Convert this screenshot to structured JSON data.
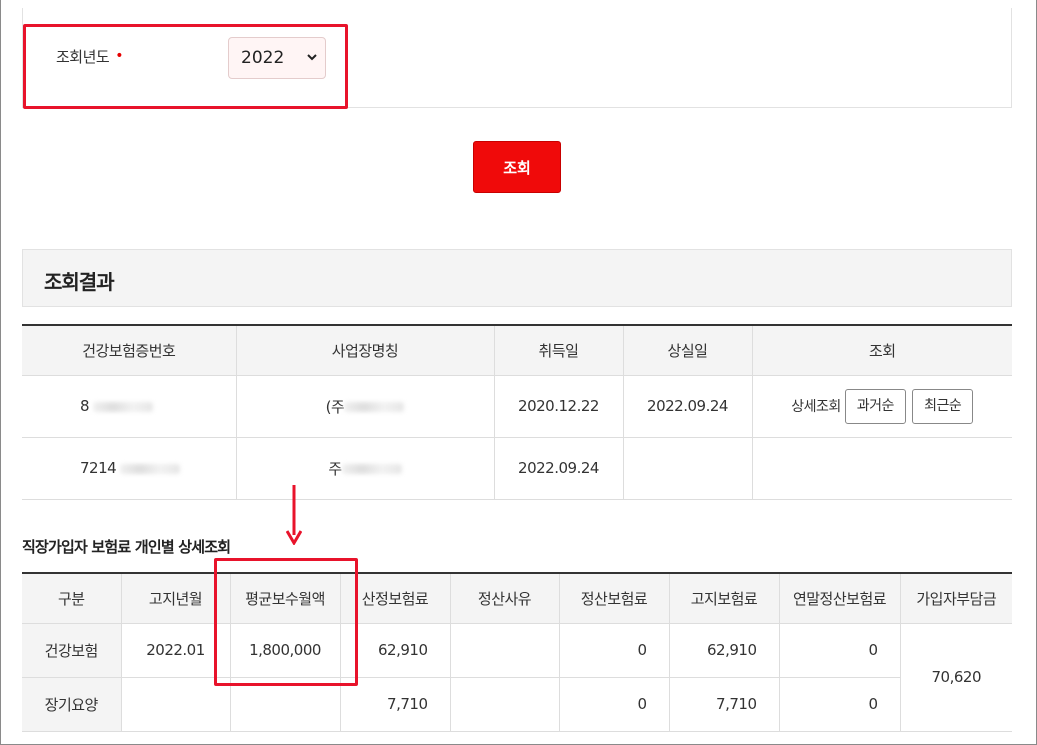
{
  "search": {
    "year_label": "조회년도",
    "required_mark": "•",
    "year_value": "2022",
    "button_label": "조회"
  },
  "result": {
    "title": "조회결과",
    "columns": [
      "건강보험증번호",
      "사업장명칭",
      "취득일",
      "상실일",
      "조회"
    ],
    "rows": [
      {
        "card_no": "8",
        "company": "(주",
        "acquired": "2020.12.22",
        "lost": "2022.09.24",
        "detail_label": "상세조회",
        "btn_past": "과거순",
        "btn_recent": "최근순"
      },
      {
        "card_no": "7214",
        "company": "주",
        "acquired": "2022.09.24",
        "lost": ""
      }
    ]
  },
  "detail": {
    "title": "직장가입자 보험료 개인별 상세조회",
    "columns": [
      "구분",
      "고지년월",
      "평균보수월액",
      "산정보험료",
      "정산사유",
      "정산보험료",
      "고지보험료",
      "연말정산보험료",
      "가입자부담금"
    ],
    "rows": [
      {
        "type": "건강보험",
        "month": "2022.01",
        "avg_pay": "1,800,000",
        "calc_premium": "62,910",
        "reason": "",
        "settle_premium": "0",
        "notice_premium": "62,910",
        "year_end": "0",
        "burden": "70,620"
      },
      {
        "type": "장기요양",
        "month": "",
        "avg_pay": "",
        "calc_premium": "7,710",
        "reason": "",
        "settle_premium": "0",
        "notice_premium": "7,710",
        "year_end": "0"
      }
    ]
  },
  "colors": {
    "accent_red": "#f00a0a",
    "highlight_red": "#e8132b",
    "header_gray": "#f4f4f4"
  }
}
